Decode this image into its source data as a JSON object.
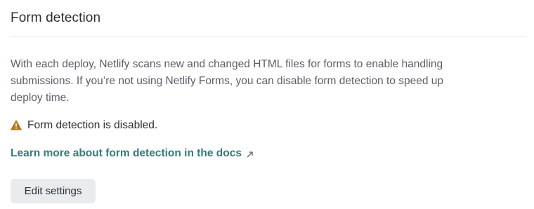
{
  "section": {
    "title": "Form detection",
    "description": "With each deploy, Netlify scans new and changed HTML files for forms to enable handling submissions. If you’re not using Netlify Forms, you can disable form detection to speed up deploy time."
  },
  "status": {
    "icon": "warning-icon",
    "text": "Form detection is disabled.",
    "color": "#b7791f"
  },
  "docs_link": {
    "label": "Learn more about form detection in the docs",
    "icon": "external-link-icon",
    "color": "#2f7e7a"
  },
  "actions": {
    "edit_settings_label": "Edit settings"
  }
}
